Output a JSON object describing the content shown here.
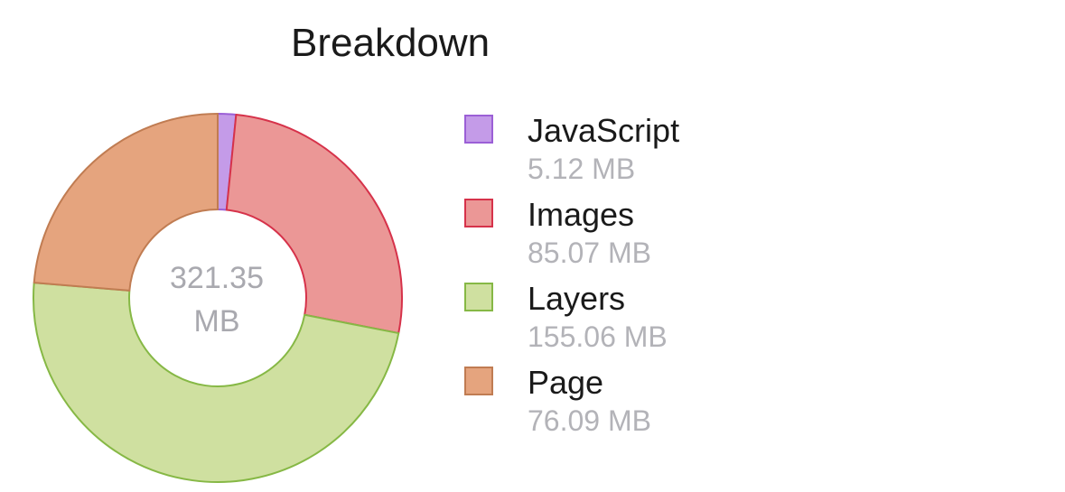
{
  "chart_data": {
    "type": "pie",
    "title": "Breakdown",
    "center_label": [
      "321.35",
      "MB"
    ],
    "categories": [
      "JavaScript",
      "Images",
      "Layers",
      "Page"
    ],
    "values": [
      5.12,
      85.07,
      155.06,
      76.09
    ],
    "value_labels": [
      "5.12 MB",
      "85.07 MB",
      "155.06 MB",
      "76.09 MB"
    ],
    "units": "MB",
    "colors": [
      {
        "fill": "#c49be8",
        "stroke": "#9b5fd6"
      },
      {
        "fill": "#eb9796",
        "stroke": "#d6324a"
      },
      {
        "fill": "#cfe0a0",
        "stroke": "#86b845"
      },
      {
        "fill": "#e5a47e",
        "stroke": "#c07c52"
      }
    ],
    "legend_position": "right"
  }
}
